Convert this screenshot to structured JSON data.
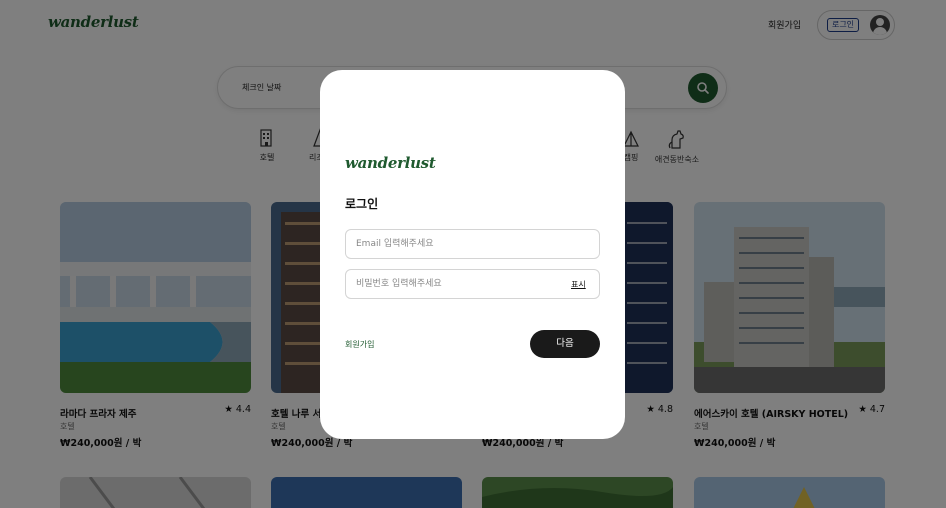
{
  "brand": {
    "name": "wanderlust",
    "color": "#1f5a2f"
  },
  "header": {
    "signup_label": "회원가입",
    "login_label": "로그인",
    "avatar_icon": "user-circle-icon"
  },
  "search": {
    "label": "체크인 날짜",
    "icon": "search-icon"
  },
  "categories": [
    {
      "label": "호텔",
      "icon": "hotel-icon"
    },
    {
      "label": "리조트",
      "icon": "resort-icon"
    },
    {
      "label": "캠핑",
      "icon": "camping-icon"
    },
    {
      "label": "애견동반숙소",
      "icon": "dog-icon"
    }
  ],
  "listings": [
    {
      "title": "라마다 프라자 제주",
      "rating": "★ 4.4",
      "type": "호텔",
      "price": "₩240,000원 / 박"
    },
    {
      "title": "호텔 나루 서울",
      "rating": "",
      "type": "호텔",
      "price": "₩240,000원 / 박"
    },
    {
      "title": "",
      "rating": "★ 4.8",
      "type": "",
      "price": "₩240,000원 / 박"
    },
    {
      "title": "에어스카이 호텔 (AIRSKY HOTEL)",
      "rating": "★ 4.7",
      "type": "호텔",
      "price": "₩240,000원 / 박"
    }
  ],
  "modal": {
    "title": "로그인",
    "email_placeholder": "Email 입력해주세요",
    "password_placeholder": "비밀번호 입력해주세요",
    "show_label": "표시",
    "signup_label": "회원가입",
    "next_label": "다음"
  }
}
